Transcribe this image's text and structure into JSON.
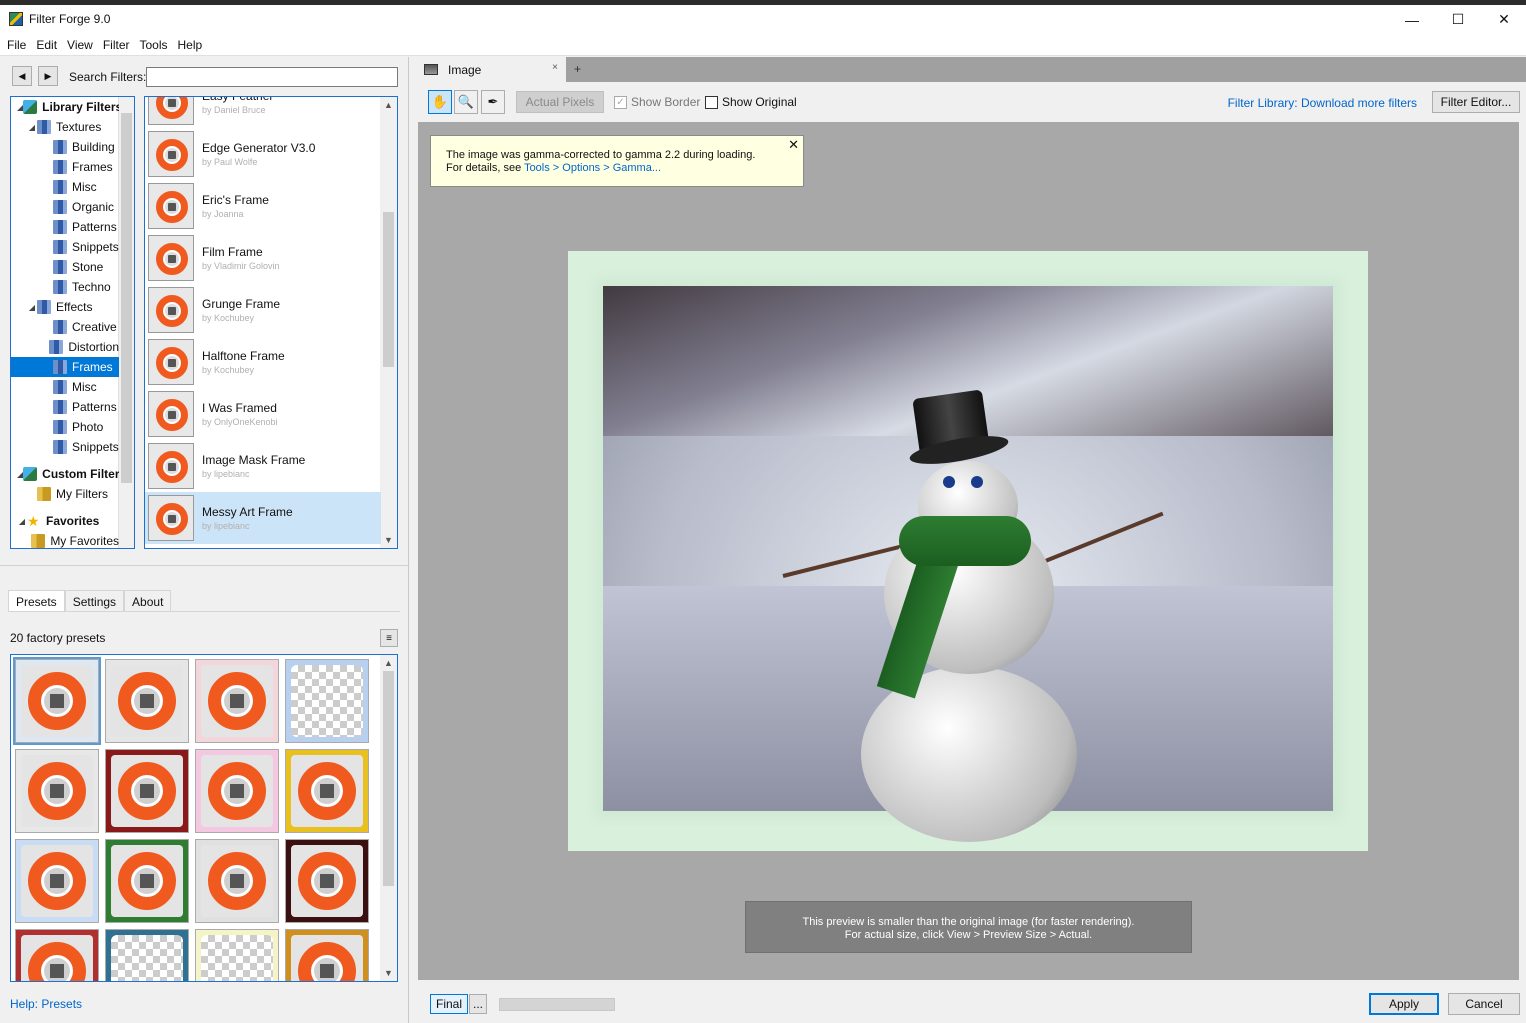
{
  "window": {
    "title": "Filter Forge 9.0",
    "minimize": "—",
    "maximize": "☐",
    "close": "✕"
  },
  "menu": [
    "File",
    "Edit",
    "View",
    "Filter",
    "Tools",
    "Help"
  ],
  "search": {
    "label": "Search Filters:",
    "value": "",
    "back": "◀",
    "forward": "▶"
  },
  "tree": [
    {
      "label": "Library Filters",
      "level": 0,
      "icon": "cube",
      "bold": true,
      "twisty": "◢"
    },
    {
      "label": "Textures",
      "level": 1,
      "icon": "folder-blue",
      "twisty": "◢"
    },
    {
      "label": "Building",
      "level": 2,
      "icon": "folder-blue"
    },
    {
      "label": "Frames",
      "level": 2,
      "icon": "folder-blue"
    },
    {
      "label": "Misc",
      "level": 2,
      "icon": "folder-blue"
    },
    {
      "label": "Organic",
      "level": 2,
      "icon": "folder-blue"
    },
    {
      "label": "Patterns",
      "level": 2,
      "icon": "folder-blue"
    },
    {
      "label": "Snippets",
      "level": 2,
      "icon": "folder-blue"
    },
    {
      "label": "Stone",
      "level": 2,
      "icon": "folder-blue"
    },
    {
      "label": "Techno",
      "level": 2,
      "icon": "folder-blue"
    },
    {
      "label": "Effects",
      "level": 1,
      "icon": "folder-blue",
      "twisty": "◢"
    },
    {
      "label": "Creative",
      "level": 2,
      "icon": "folder-blue"
    },
    {
      "label": "Distortion",
      "level": 2,
      "icon": "folder-blue"
    },
    {
      "label": "Frames",
      "level": 2,
      "icon": "folder-blue",
      "selected": true
    },
    {
      "label": "Misc",
      "level": 2,
      "icon": "folder-blue"
    },
    {
      "label": "Patterns",
      "level": 2,
      "icon": "folder-blue"
    },
    {
      "label": "Photo",
      "level": 2,
      "icon": "folder-blue"
    },
    {
      "label": "Snippets",
      "level": 2,
      "icon": "folder-blue"
    },
    {
      "label": "Custom Filters",
      "level": 0,
      "icon": "cube",
      "bold": true,
      "twisty": "◢"
    },
    {
      "label": "My Filters",
      "level": 1,
      "icon": "folder-gold"
    },
    {
      "label": "Favorites",
      "level": 0,
      "icon": "star",
      "bold": true,
      "twisty": "◢"
    },
    {
      "label": "My Favorites",
      "level": 1,
      "icon": "folder-gold"
    }
  ],
  "filters": [
    {
      "name": "Easy Feather",
      "author": "by Daniel Bruce"
    },
    {
      "name": "Edge Generator V3.0",
      "author": "by Paul Wolfe"
    },
    {
      "name": "Eric's Frame",
      "author": "by Joanna"
    },
    {
      "name": "Film Frame",
      "author": "by Vladimir Golovin"
    },
    {
      "name": "Grunge Frame",
      "author": "by Kochubey"
    },
    {
      "name": "Halftone Frame",
      "author": "by Kochubey"
    },
    {
      "name": "I Was Framed",
      "author": "by OnlyOneKenobi"
    },
    {
      "name": "Image Mask Frame",
      "author": "by lipebianc"
    },
    {
      "name": "Messy Art Frame",
      "author": "by lipebianc",
      "selected": true
    }
  ],
  "tabs": [
    "Presets",
    "Settings",
    "About"
  ],
  "presets": {
    "count_label": "20 factory presets",
    "menu_icon": "≡",
    "items": [
      {
        "bg": "#dfe8f0",
        "type": "ring",
        "selected": true
      },
      {
        "bg": "#e6e6e6",
        "type": "ring"
      },
      {
        "bg": "#f2d6dc",
        "type": "ring"
      },
      {
        "bg": "#b8d0f0",
        "type": "checker"
      },
      {
        "bg": "#e8e8e8",
        "type": "ring"
      },
      {
        "bg": "#8a1a1a",
        "type": "ring"
      },
      {
        "bg": "#f4c8e0",
        "type": "ring"
      },
      {
        "bg": "#e8c020",
        "type": "ring"
      },
      {
        "bg": "#c8dcf4",
        "type": "ring"
      },
      {
        "bg": "#2e7d32",
        "type": "ring"
      },
      {
        "bg": "#e0e0e0",
        "type": "ring"
      },
      {
        "bg": "#3a1010",
        "type": "ring"
      },
      {
        "bg": "#b03030",
        "type": "ring"
      },
      {
        "bg": "#307090",
        "type": "checker"
      },
      {
        "bg": "#f4f4c8",
        "type": "checker"
      },
      {
        "bg": "#d09020",
        "type": "ring"
      }
    ]
  },
  "help": {
    "label": "Help: Presets"
  },
  "doc": {
    "tab_label": "Image",
    "tab_close": "×",
    "tab_add": "+"
  },
  "toolbar": {
    "hand_icon": "✋",
    "zoom_icon": "🔍",
    "picker_icon": "✒",
    "actual_pixels": "Actual Pixels",
    "show_border": "Show Border",
    "show_original": "Show Original",
    "show_border_checked": "✓",
    "library_link": "Filter Library: Download more filters",
    "filter_editor": "Filter Editor..."
  },
  "notice": {
    "line1": "The image was gamma-corrected to gamma 2.2 during loading.",
    "line2_prefix": "For details, see ",
    "line2_link": "Tools > Options > Gamma...",
    "close": "✕"
  },
  "preview_info": {
    "line1": "This preview is smaller than the original image (for faster rendering).",
    "line2": "For actual size, click View > Preview Size > Actual."
  },
  "status": {
    "final": "Final",
    "more": "...",
    "apply": "Apply",
    "cancel": "Cancel"
  }
}
